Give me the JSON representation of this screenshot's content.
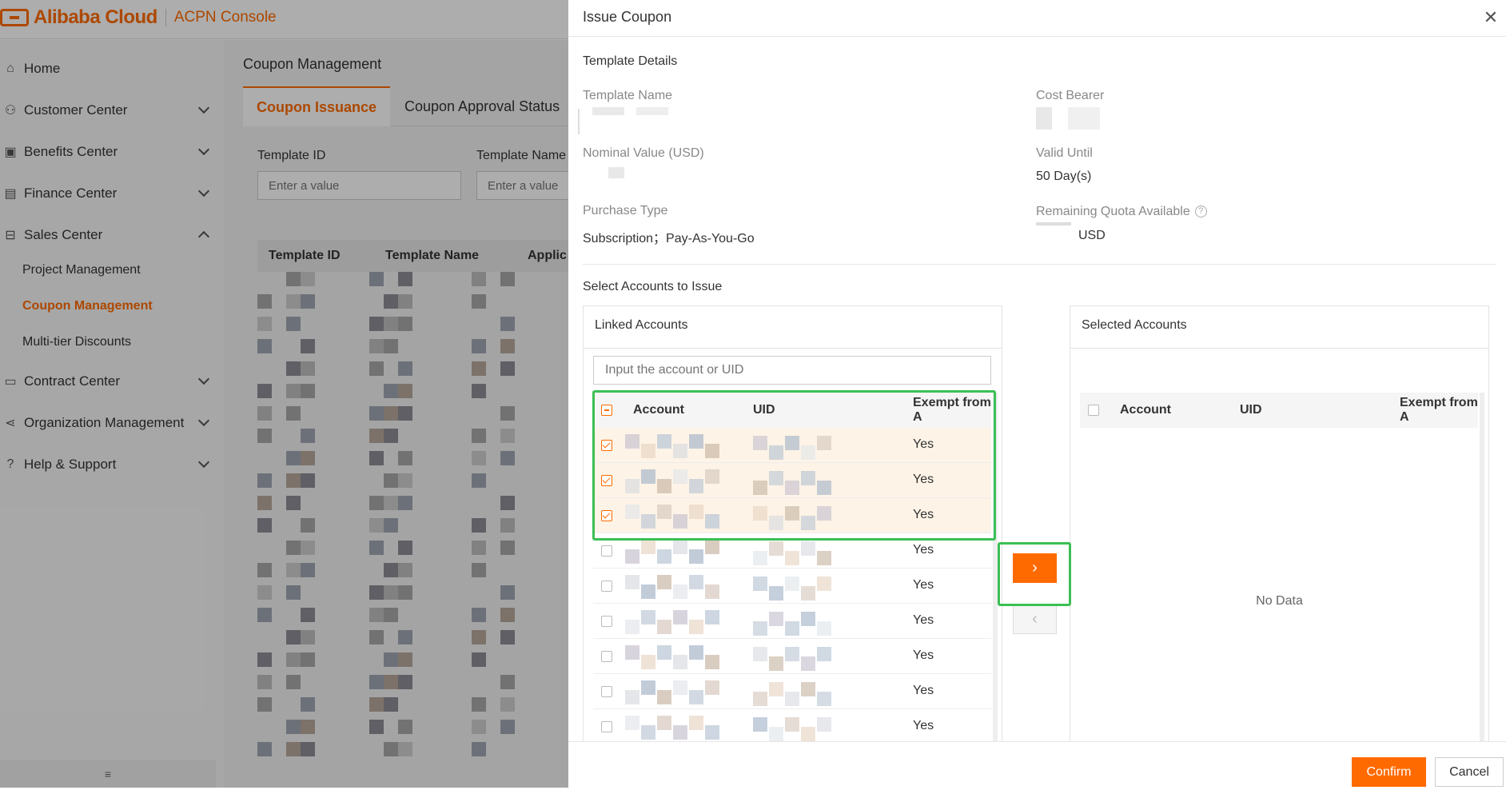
{
  "brand": {
    "logo_text": "Alibaba Cloud",
    "console_name": "ACPN Console",
    "accent": "#ff6a00"
  },
  "sidebar": {
    "items": [
      {
        "label": "Home",
        "icon": "home-icon",
        "expandable": false
      },
      {
        "label": "Customer Center",
        "icon": "user-icon",
        "expandable": true
      },
      {
        "label": "Benefits Center",
        "icon": "benefits-icon",
        "expandable": true
      },
      {
        "label": "Finance Center",
        "icon": "finance-icon",
        "expandable": true
      },
      {
        "label": "Sales Center",
        "icon": "sales-icon",
        "expandable": true,
        "expanded": true
      },
      {
        "label": "Contract Center",
        "icon": "contract-icon",
        "expandable": true
      },
      {
        "label": "Organization Management",
        "icon": "org-icon",
        "expandable": true
      },
      {
        "label": "Help & Support",
        "icon": "help-icon",
        "expandable": true
      }
    ],
    "sales_children": [
      {
        "label": "Project Management",
        "active": false
      },
      {
        "label": "Coupon Management",
        "active": true
      },
      {
        "label": "Multi-tier Discounts",
        "active": false
      }
    ],
    "collapse_icon": "menu-icon"
  },
  "main": {
    "page_title": "Coupon Management",
    "tabs": [
      {
        "label": "Coupon Issuance",
        "active": true
      },
      {
        "label": "Coupon Approval Status",
        "active": false
      }
    ],
    "filters": [
      {
        "label": "Template ID",
        "placeholder": "Enter a value"
      },
      {
        "label": "Template Name",
        "placeholder": "Enter a value"
      }
    ],
    "table_headers": [
      "Template ID",
      "Template Name",
      "Applic"
    ]
  },
  "drawer": {
    "title": "Issue Coupon",
    "close_icon": "close-icon",
    "template_details": {
      "section_title": "Template Details",
      "template_name_label": "Template Name",
      "cost_bearer_label": "Cost Bearer",
      "nominal_value_label": "Nominal Value (USD)",
      "valid_until_label": "Valid Until",
      "valid_until_value": "50 Day(s)",
      "purchase_type_label": "Purchase Type",
      "purchase_type_value": "Subscription；Pay-As-You-Go",
      "remaining_quota_label": "Remaining Quota Available",
      "remaining_quota_unit": "USD"
    },
    "select_accounts": {
      "section_title": "Select Accounts to Issue",
      "linked": {
        "title": "Linked Accounts",
        "search_placeholder": "Input the account or UID",
        "columns": [
          "Account",
          "UID",
          "Exempt from A"
        ],
        "rows": [
          {
            "checked": true,
            "exempt": "Yes"
          },
          {
            "checked": true,
            "exempt": "Yes"
          },
          {
            "checked": true,
            "exempt": "Yes"
          },
          {
            "checked": false,
            "exempt": "Yes"
          },
          {
            "checked": false,
            "exempt": "Yes"
          },
          {
            "checked": false,
            "exempt": "Yes"
          },
          {
            "checked": false,
            "exempt": "Yes"
          },
          {
            "checked": false,
            "exempt": "Yes"
          },
          {
            "checked": false,
            "exempt": "Yes"
          }
        ]
      },
      "selected": {
        "title": "Selected Accounts",
        "columns": [
          "Account",
          "UID",
          "Exempt from A"
        ],
        "empty_text": "No Data"
      },
      "move_right_icon": "chevron-right-icon",
      "move_left_icon": "chevron-left-icon"
    },
    "footer": {
      "confirm_label": "Confirm",
      "cancel_label": "Cancel"
    }
  },
  "highlight_color": "#3bbf55"
}
